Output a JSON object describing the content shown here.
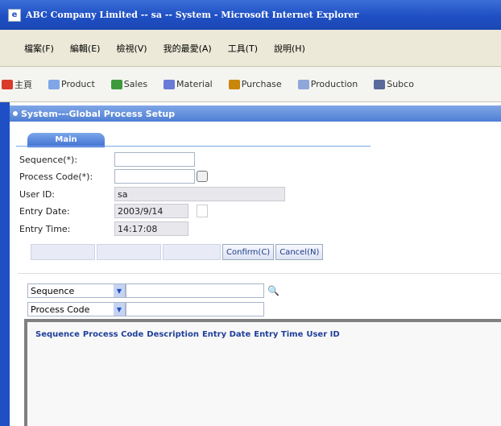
{
  "window": {
    "title": "ABC Company Limited -- sa -- System - Microsoft Internet Explorer"
  },
  "menubar": [
    "檔案(F)",
    "編輯(E)",
    "檢視(V)",
    "我的最愛(A)",
    "工具(T)",
    "說明(H)"
  ],
  "nav": {
    "tabs": [
      {
        "label": "主頁",
        "icon": "home-icon",
        "color": "#d93a2a"
      },
      {
        "label": "Product",
        "icon": "product-icon",
        "color": "#7fa6e6"
      },
      {
        "label": "Sales",
        "icon": "sales-icon",
        "color": "#3c9a3c"
      },
      {
        "label": "Material",
        "icon": "material-icon",
        "color": "#6a7ad8"
      },
      {
        "label": "Purchase",
        "icon": "purchase-icon",
        "color": "#c8860a"
      },
      {
        "label": "Production",
        "icon": "production-icon",
        "color": "#8fa6d8"
      },
      {
        "label": "Subco",
        "icon": "subcontract-icon",
        "color": "#5a6a9a"
      }
    ]
  },
  "section": {
    "title": "System---Global Process Setup"
  },
  "main_tab": {
    "label": "Main"
  },
  "form": {
    "sequence_label": "Sequence(*):",
    "sequence_value": "",
    "process_code_label": "Process Code(*):",
    "process_code_value": "",
    "user_id_label": "User ID:",
    "user_id_value": "sa",
    "entry_date_label": "Entry Date:",
    "entry_date_value": "2003/9/14",
    "entry_time_label": "Entry Time:",
    "entry_time_value": "14:17:08"
  },
  "buttons": {
    "disabled_1": "",
    "disabled_2": "",
    "disabled_3": "",
    "confirm": "Confirm(C)",
    "cancel": "Cancel(N)"
  },
  "search": {
    "field1": "Sequence",
    "field2": "Process Code",
    "value1": "",
    "value2": ""
  },
  "results": {
    "columns": [
      "Sequence",
      "Process Code",
      "Description",
      "Entry Date",
      "Entry Time",
      "User ID"
    ]
  },
  "colors": {
    "accent": "#1f4fc4",
    "section_bar": "#4f7ed4"
  }
}
